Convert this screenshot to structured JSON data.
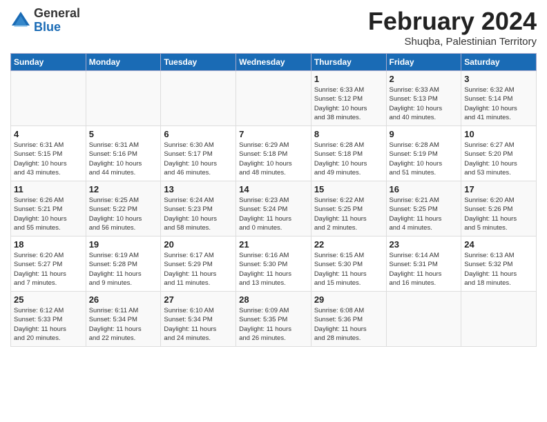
{
  "logo": {
    "general": "General",
    "blue": "Blue"
  },
  "header": {
    "title": "February 2024",
    "subtitle": "Shuqba, Palestinian Territory"
  },
  "weekdays": [
    "Sunday",
    "Monday",
    "Tuesday",
    "Wednesday",
    "Thursday",
    "Friday",
    "Saturday"
  ],
  "weeks": [
    [
      {
        "day": "",
        "info": ""
      },
      {
        "day": "",
        "info": ""
      },
      {
        "day": "",
        "info": ""
      },
      {
        "day": "",
        "info": ""
      },
      {
        "day": "1",
        "info": "Sunrise: 6:33 AM\nSunset: 5:12 PM\nDaylight: 10 hours\nand 38 minutes."
      },
      {
        "day": "2",
        "info": "Sunrise: 6:33 AM\nSunset: 5:13 PM\nDaylight: 10 hours\nand 40 minutes."
      },
      {
        "day": "3",
        "info": "Sunrise: 6:32 AM\nSunset: 5:14 PM\nDaylight: 10 hours\nand 41 minutes."
      }
    ],
    [
      {
        "day": "4",
        "info": "Sunrise: 6:31 AM\nSunset: 5:15 PM\nDaylight: 10 hours\nand 43 minutes."
      },
      {
        "day": "5",
        "info": "Sunrise: 6:31 AM\nSunset: 5:16 PM\nDaylight: 10 hours\nand 44 minutes."
      },
      {
        "day": "6",
        "info": "Sunrise: 6:30 AM\nSunset: 5:17 PM\nDaylight: 10 hours\nand 46 minutes."
      },
      {
        "day": "7",
        "info": "Sunrise: 6:29 AM\nSunset: 5:18 PM\nDaylight: 10 hours\nand 48 minutes."
      },
      {
        "day": "8",
        "info": "Sunrise: 6:28 AM\nSunset: 5:18 PM\nDaylight: 10 hours\nand 49 minutes."
      },
      {
        "day": "9",
        "info": "Sunrise: 6:28 AM\nSunset: 5:19 PM\nDaylight: 10 hours\nand 51 minutes."
      },
      {
        "day": "10",
        "info": "Sunrise: 6:27 AM\nSunset: 5:20 PM\nDaylight: 10 hours\nand 53 minutes."
      }
    ],
    [
      {
        "day": "11",
        "info": "Sunrise: 6:26 AM\nSunset: 5:21 PM\nDaylight: 10 hours\nand 55 minutes."
      },
      {
        "day": "12",
        "info": "Sunrise: 6:25 AM\nSunset: 5:22 PM\nDaylight: 10 hours\nand 56 minutes."
      },
      {
        "day": "13",
        "info": "Sunrise: 6:24 AM\nSunset: 5:23 PM\nDaylight: 10 hours\nand 58 minutes."
      },
      {
        "day": "14",
        "info": "Sunrise: 6:23 AM\nSunset: 5:24 PM\nDaylight: 11 hours\nand 0 minutes."
      },
      {
        "day": "15",
        "info": "Sunrise: 6:22 AM\nSunset: 5:25 PM\nDaylight: 11 hours\nand 2 minutes."
      },
      {
        "day": "16",
        "info": "Sunrise: 6:21 AM\nSunset: 5:25 PM\nDaylight: 11 hours\nand 4 minutes."
      },
      {
        "day": "17",
        "info": "Sunrise: 6:20 AM\nSunset: 5:26 PM\nDaylight: 11 hours\nand 5 minutes."
      }
    ],
    [
      {
        "day": "18",
        "info": "Sunrise: 6:20 AM\nSunset: 5:27 PM\nDaylight: 11 hours\nand 7 minutes."
      },
      {
        "day": "19",
        "info": "Sunrise: 6:19 AM\nSunset: 5:28 PM\nDaylight: 11 hours\nand 9 minutes."
      },
      {
        "day": "20",
        "info": "Sunrise: 6:17 AM\nSunset: 5:29 PM\nDaylight: 11 hours\nand 11 minutes."
      },
      {
        "day": "21",
        "info": "Sunrise: 6:16 AM\nSunset: 5:30 PM\nDaylight: 11 hours\nand 13 minutes."
      },
      {
        "day": "22",
        "info": "Sunrise: 6:15 AM\nSunset: 5:30 PM\nDaylight: 11 hours\nand 15 minutes."
      },
      {
        "day": "23",
        "info": "Sunrise: 6:14 AM\nSunset: 5:31 PM\nDaylight: 11 hours\nand 16 minutes."
      },
      {
        "day": "24",
        "info": "Sunrise: 6:13 AM\nSunset: 5:32 PM\nDaylight: 11 hours\nand 18 minutes."
      }
    ],
    [
      {
        "day": "25",
        "info": "Sunrise: 6:12 AM\nSunset: 5:33 PM\nDaylight: 11 hours\nand 20 minutes."
      },
      {
        "day": "26",
        "info": "Sunrise: 6:11 AM\nSunset: 5:34 PM\nDaylight: 11 hours\nand 22 minutes."
      },
      {
        "day": "27",
        "info": "Sunrise: 6:10 AM\nSunset: 5:34 PM\nDaylight: 11 hours\nand 24 minutes."
      },
      {
        "day": "28",
        "info": "Sunrise: 6:09 AM\nSunset: 5:35 PM\nDaylight: 11 hours\nand 26 minutes."
      },
      {
        "day": "29",
        "info": "Sunrise: 6:08 AM\nSunset: 5:36 PM\nDaylight: 11 hours\nand 28 minutes."
      },
      {
        "day": "",
        "info": ""
      },
      {
        "day": "",
        "info": ""
      }
    ]
  ]
}
